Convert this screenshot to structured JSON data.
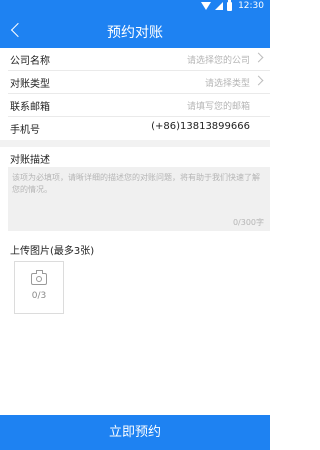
{
  "status_bar": {
    "time": "12:30"
  },
  "nav": {
    "title": "预约对账"
  },
  "form": {
    "fields": [
      {
        "label": "公司名称",
        "value": "请选择您的公司"
      },
      {
        "label": "对账类型",
        "value": "请选择类型"
      },
      {
        "label": "联系邮箱",
        "value": "请填写您的邮箱"
      },
      {
        "label": "手机号",
        "value": "(+86)13813899666"
      }
    ],
    "description": {
      "label": "对账描述",
      "placeholder": "该项为必填项，请晰详细的描述您的对账问题，将有助于我们快速了解您的情况。",
      "counter": "0/300字"
    },
    "upload": {
      "label": "上传图片(最多3张)",
      "count": "0/3"
    }
  },
  "submit_label": "立即预约",
  "colors": {
    "primary": "#1e82f2",
    "placeholder": "#b5b5b5"
  }
}
